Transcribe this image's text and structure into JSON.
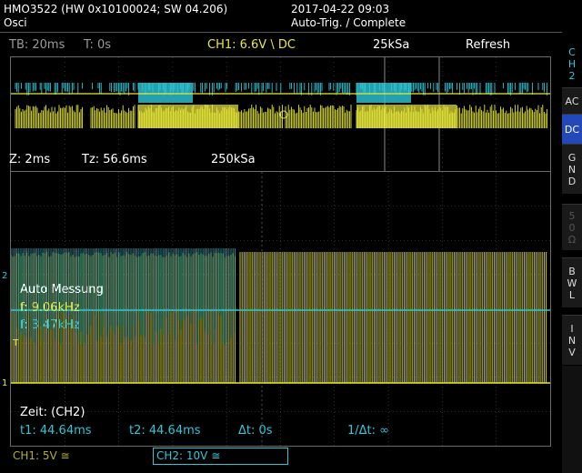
{
  "header": {
    "device": "HMO3522 (HW 0x10100024; SW 04.206)",
    "app": "Osci",
    "datetime": "2017-04-22 09:03",
    "trigger_status": "Auto-Trig. / Complete"
  },
  "overview": {
    "timebase": "TB: 20ms",
    "trigger_time": "T: 0s",
    "channel_info": "CH1: 6.6V \\ DC",
    "sample_rate": "25kSa",
    "mode": "Refresh"
  },
  "zoom_info": {
    "zoom": "Z: 2ms",
    "tz": "Tz: 56.6ms",
    "sample_rate": "250kSa"
  },
  "measurement": {
    "title": "Auto Messung",
    "freq1": "f: 9.06kHz",
    "freq2": "f: 3.47kHz",
    "cursor_title": "Zeit: (CH2)",
    "t1": "t1: 44.64ms",
    "t2": "t2: 44.64ms",
    "dt": "Δt: 0s",
    "inv_dt": "1/Δt: ∞"
  },
  "status_bar": {
    "ch1": "CH1: 5V ≅",
    "ch2": "CH2: 10V ≅"
  },
  "side_menu": {
    "channel_label": [
      "C",
      "H",
      "2"
    ],
    "ac": "AC",
    "dc": "DC",
    "gnd": [
      "G",
      "N",
      "D"
    ],
    "fifty": [
      "5",
      "0",
      "Ω"
    ],
    "bwl": [
      "B",
      "W",
      "L"
    ],
    "inv": [
      "I",
      "N",
      "V"
    ]
  },
  "markers": {
    "ch2_marker": "2",
    "ch1_marker": "1",
    "trigger_marker": "T"
  },
  "colors": {
    "ch1": "#e8e83a",
    "ch2": "#2ec8d8",
    "active_button": "#2448b8",
    "grid": "#555555"
  }
}
